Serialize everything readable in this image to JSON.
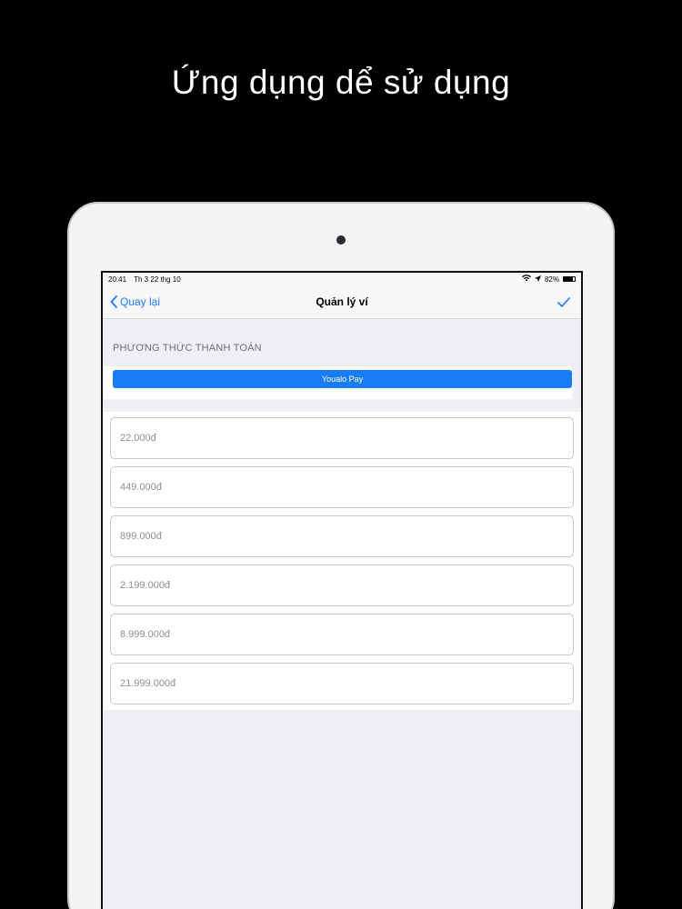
{
  "promo": {
    "title": "Ứng dụng dể sử dụng"
  },
  "status_bar": {
    "time": "20:41",
    "date": "Th 3 22 thg 10",
    "battery_text": "82%",
    "battery_level": 0.82
  },
  "nav": {
    "back_label": "Quay lại",
    "title": "Quản lý ví",
    "accent_color": "#1a7cf5"
  },
  "payment": {
    "section_header": "PHƯƠNG THỨC THANH TOÁN",
    "method_label": "Youalo Pay"
  },
  "amounts": [
    {
      "label": "22.000đ"
    },
    {
      "label": "449.000đ"
    },
    {
      "label": "899.000đ"
    },
    {
      "label": "2.199.000đ"
    },
    {
      "label": "8.999.000đ"
    },
    {
      "label": "21.999.000đ"
    }
  ],
  "icons": [
    "chevron-left-icon",
    "checkmark-icon",
    "wifi-icon",
    "location-arrow-icon",
    "battery-icon"
  ]
}
